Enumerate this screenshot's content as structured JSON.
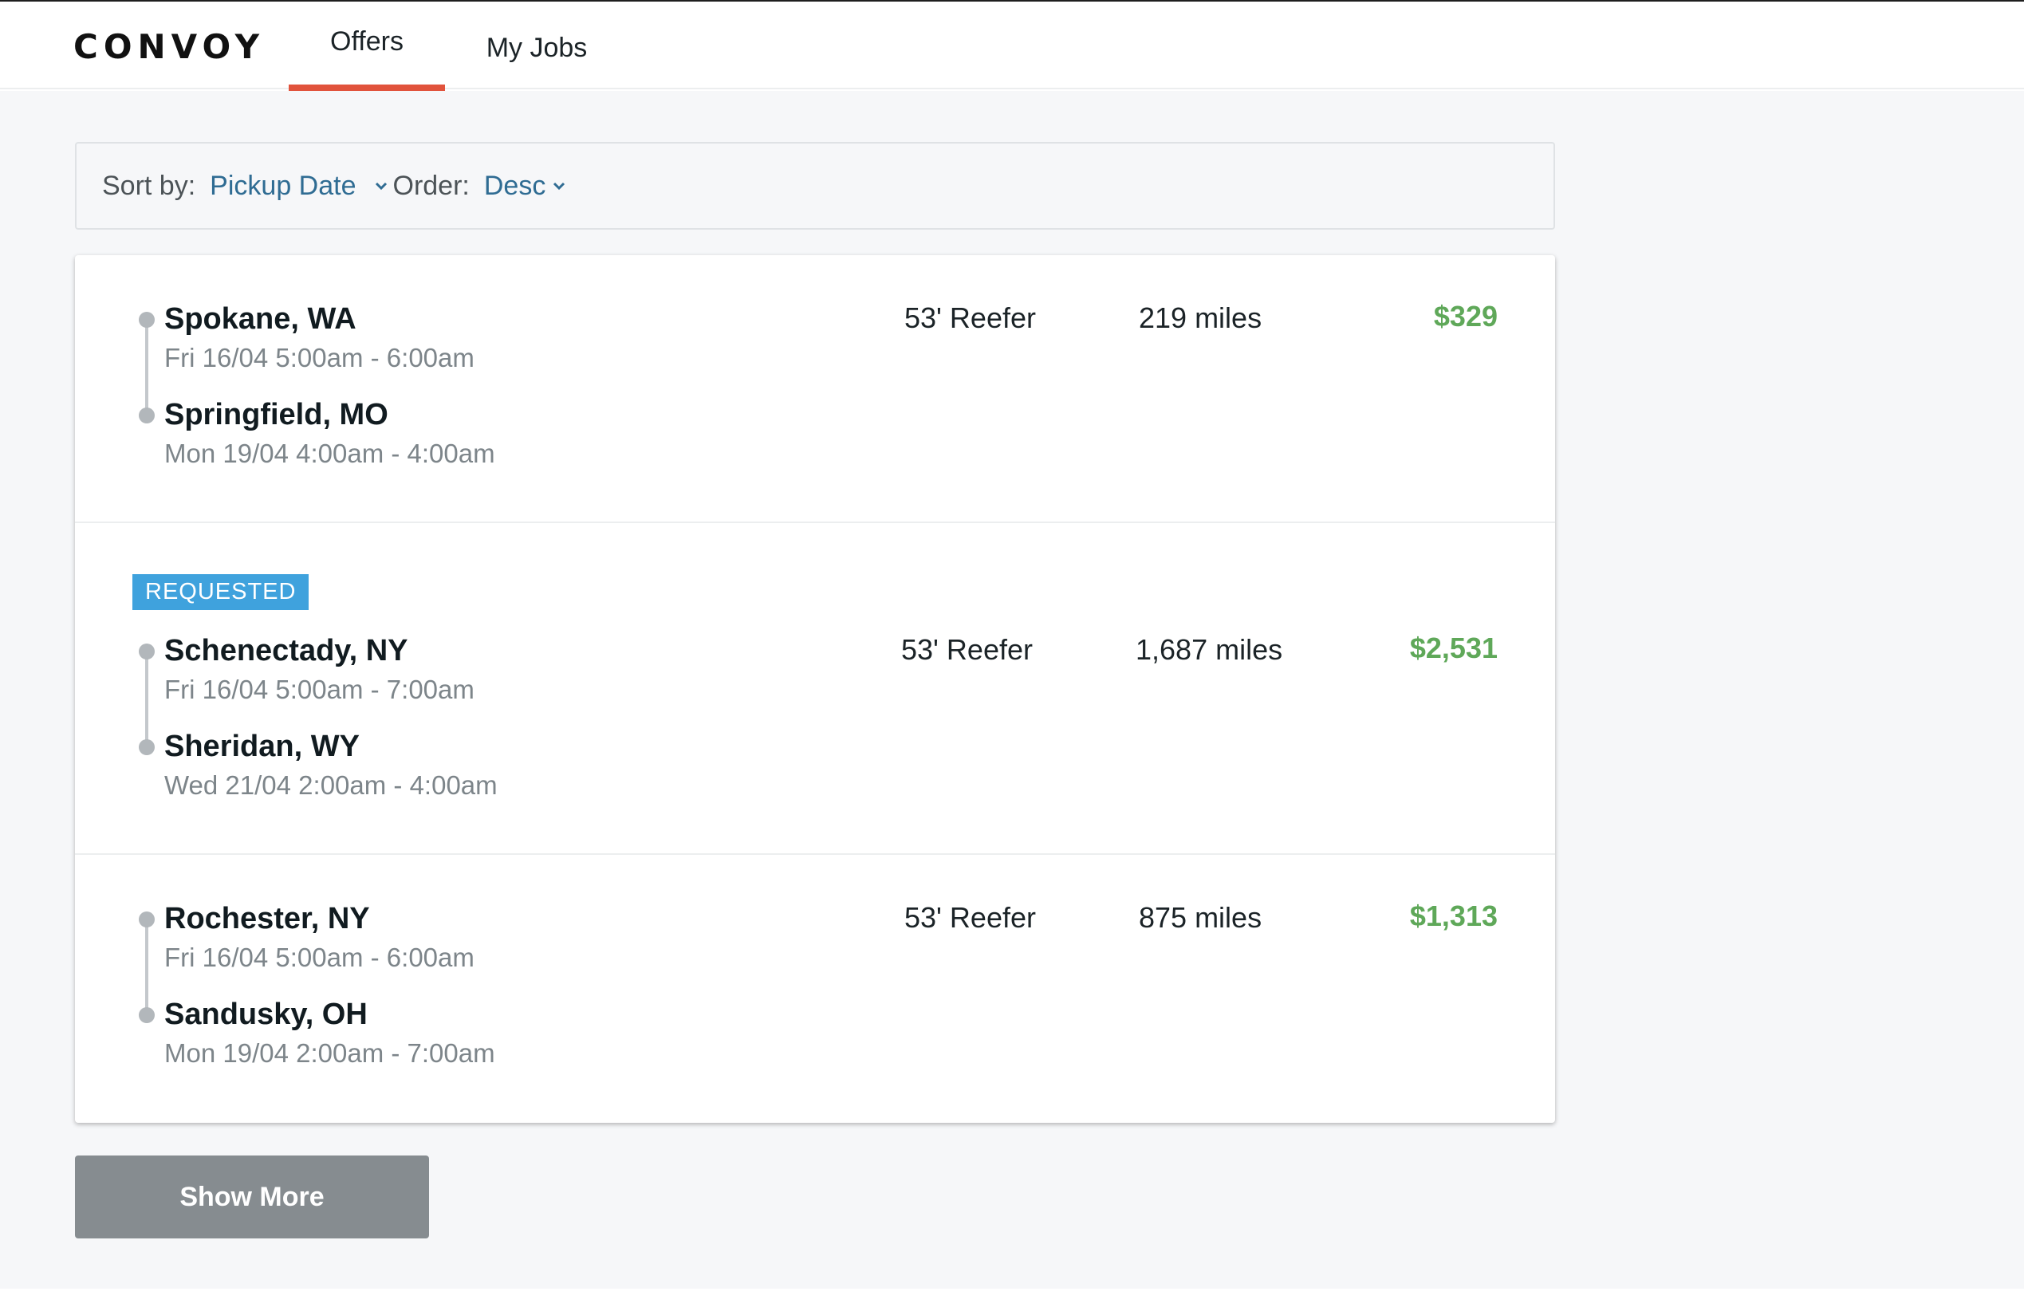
{
  "brand": {
    "logo": "CONVOY"
  },
  "nav": {
    "tabs": [
      {
        "label": "Offers",
        "active": true
      },
      {
        "label": "My Jobs",
        "active": false
      }
    ],
    "accent_color": "#e1533c"
  },
  "sort": {
    "sort_by_label": "Sort by:",
    "sort_by_value": "Pickup Date",
    "order_label": "Order:",
    "order_value": "Desc"
  },
  "offers": [
    {
      "badge": "",
      "origin": {
        "city": "Spokane, WA",
        "window": "Fri 16/04 5:00am - 6:00am"
      },
      "destination": {
        "city": "Springfield, MO",
        "window": "Mon 19/04 4:00am - 4:00am"
      },
      "equipment": "53' Reefer",
      "distance": "219 miles",
      "price": "$329"
    },
    {
      "badge": "REQUESTED",
      "origin": {
        "city": "Schenectady, NY",
        "window": "Fri 16/04 5:00am - 7:00am"
      },
      "destination": {
        "city": "Sheridan, WY",
        "window": "Wed 21/04 2:00am - 4:00am"
      },
      "equipment": "53' Reefer",
      "distance": "1,687 miles",
      "price": "$2,531"
    },
    {
      "badge": "",
      "origin": {
        "city": "Rochester, NY",
        "window": "Fri 16/04 5:00am - 6:00am"
      },
      "destination": {
        "city": "Sandusky, OH",
        "window": "Mon 19/04 2:00am - 7:00am"
      },
      "equipment": "53' Reefer",
      "distance": "875 miles",
      "price": "$1,313"
    }
  ],
  "actions": {
    "show_more_label": "Show More"
  },
  "colors": {
    "price": "#5fa859",
    "link": "#2f6c93",
    "badge": "#3fa2dd",
    "button": "#868c90"
  }
}
